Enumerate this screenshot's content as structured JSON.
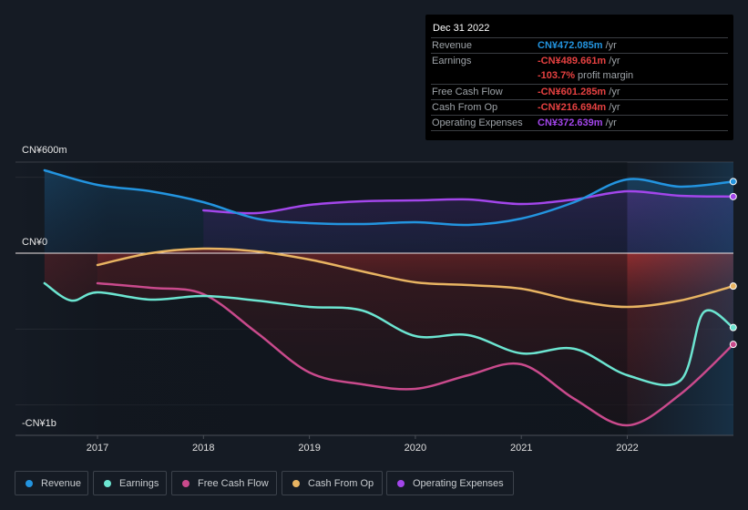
{
  "tooltip": {
    "date": "Dec 31 2022",
    "rows": [
      {
        "label": "Revenue",
        "value": "CN¥472.085m",
        "unit": " /yr",
        "color": "#2394df"
      },
      {
        "label": "Earnings",
        "value": "-CN¥489.661m",
        "unit": " /yr",
        "color": "#e64141"
      },
      {
        "label": "",
        "value": "-103.7%",
        "unit": " profit margin",
        "color": "#e64141"
      },
      {
        "label": "Free Cash Flow",
        "value": "-CN¥601.285m",
        "unit": " /yr",
        "color": "#e64141"
      },
      {
        "label": "Cash From Op",
        "value": "-CN¥216.694m",
        "unit": " /yr",
        "color": "#e64141"
      },
      {
        "label": "Operating Expenses",
        "value": "CN¥372.639m",
        "unit": " /yr",
        "color": "#a346eb"
      }
    ]
  },
  "legend": [
    {
      "label": "Revenue",
      "color": "#2394df"
    },
    {
      "label": "Earnings",
      "color": "#6ce5d1"
    },
    {
      "label": "Free Cash Flow",
      "color": "#c94a8c"
    },
    {
      "label": "Cash From Op",
      "color": "#e8b462"
    },
    {
      "label": "Operating Expenses",
      "color": "#a346eb"
    }
  ],
  "chart_data": {
    "type": "line",
    "title": "",
    "xlabel": "",
    "ylabel": "",
    "y_tick_labels": [
      {
        "label": "CN¥600m",
        "value": 600
      },
      {
        "label": "CN¥0",
        "value": 0
      },
      {
        "label": "-CN¥1b",
        "value": -1000
      }
    ],
    "ylim": [
      -1200,
      600
    ],
    "x_tick_labels": [
      "2017",
      "2018",
      "2019",
      "2020",
      "2021",
      "2022"
    ],
    "x_ticks": [
      2017,
      2018,
      2019,
      2020,
      2021,
      2022
    ],
    "xlim": [
      2016.5,
      2023.0
    ],
    "grid": true,
    "legend_position": "bottom-left",
    "highlight_start": 2022.0,
    "units": "CN¥ millions",
    "series": [
      {
        "name": "Revenue",
        "color": "#2394df",
        "x": [
          2016.5,
          2017.0,
          2017.5,
          2018.0,
          2018.5,
          2019.0,
          2019.5,
          2020.0,
          2020.5,
          2021.0,
          2021.5,
          2022.0,
          2022.5,
          2023.0
        ],
        "values": [
          546,
          450,
          408,
          336,
          228,
          198,
          192,
          204,
          186,
          228,
          336,
          486,
          438,
          472
        ]
      },
      {
        "name": "Earnings",
        "color": "#6ce5d1",
        "x": [
          2016.5,
          2016.75,
          2017.0,
          2017.5,
          2018.0,
          2018.5,
          2019.0,
          2019.5,
          2020.0,
          2020.5,
          2021.0,
          2021.5,
          2022.0,
          2022.5,
          2022.72,
          2023.0
        ],
        "values": [
          -198,
          -312,
          -258,
          -306,
          -282,
          -312,
          -354,
          -378,
          -546,
          -540,
          -660,
          -630,
          -804,
          -840,
          -390,
          -490
        ]
      },
      {
        "name": "Free Cash Flow",
        "color": "#c94a8c",
        "x": [
          2017.0,
          2017.5,
          2018.0,
          2018.5,
          2019.0,
          2019.5,
          2020.0,
          2020.5,
          2021.0,
          2021.5,
          2022.0,
          2022.5,
          2023.0
        ],
        "values": [
          -198,
          -228,
          -270,
          -522,
          -786,
          -864,
          -894,
          -804,
          -732,
          -960,
          -1134,
          -930,
          -601
        ]
      },
      {
        "name": "Cash From Op",
        "color": "#e8b462",
        "x": [
          2017.0,
          2017.5,
          2018.0,
          2018.5,
          2019.0,
          2019.5,
          2020.0,
          2020.5,
          2021.0,
          2021.5,
          2022.0,
          2022.5,
          2023.0
        ],
        "values": [
          -78,
          0,
          30,
          12,
          -42,
          -120,
          -192,
          -210,
          -234,
          -312,
          -354,
          -312,
          -217
        ]
      },
      {
        "name": "Operating Expenses",
        "color": "#a346eb",
        "x": [
          2018.0,
          2018.5,
          2019.0,
          2019.5,
          2020.0,
          2020.5,
          2021.0,
          2021.5,
          2022.0,
          2022.5,
          2023.0
        ],
        "values": [
          282,
          264,
          318,
          342,
          348,
          354,
          324,
          354,
          408,
          378,
          373
        ]
      }
    ]
  }
}
